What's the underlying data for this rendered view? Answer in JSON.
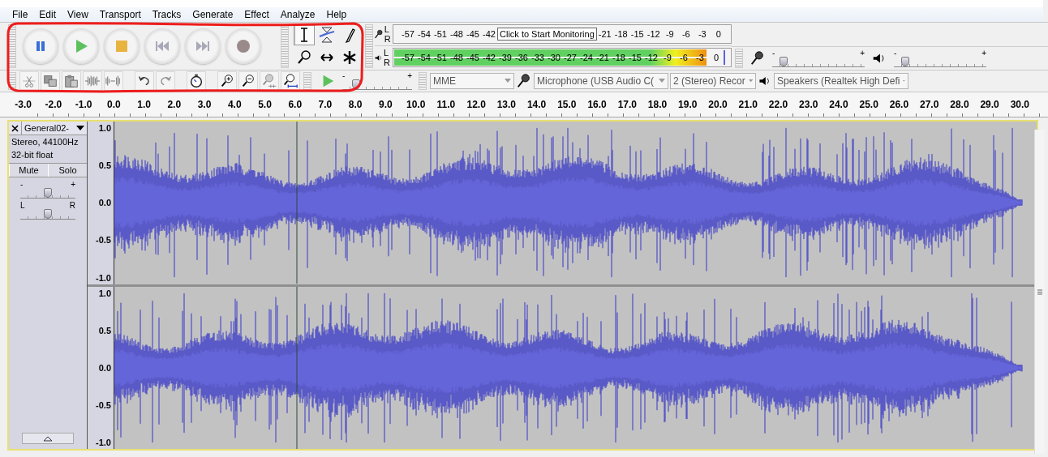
{
  "menu": [
    "File",
    "Edit",
    "View",
    "Transport",
    "Tracks",
    "Generate",
    "Effect",
    "Analyze",
    "Help"
  ],
  "transport": [
    {
      "kind": "pause"
    },
    {
      "kind": "play"
    },
    {
      "kind": "stop"
    },
    {
      "kind": "skip_start"
    },
    {
      "kind": "skip_end"
    },
    {
      "kind": "record"
    }
  ],
  "tools": [
    {
      "kind": "select",
      "selected": true
    },
    {
      "kind": "envelope",
      "selected": false
    },
    {
      "kind": "draw",
      "selected": false
    },
    {
      "kind": "zoom",
      "selected": false
    },
    {
      "kind": "timeshift",
      "selected": false
    },
    {
      "kind": "multi",
      "selected": false
    }
  ],
  "record_meter": {
    "channels": [
      "L",
      "R"
    ],
    "left_labels": [
      "-57",
      "-54",
      "-51",
      "-48",
      "-45",
      "-42"
    ],
    "tooltip": "Click to Start Monitoring",
    "right_labels": [
      "-21",
      "-18",
      "-15",
      "-12",
      "-9",
      "-6",
      "-3",
      "0"
    ]
  },
  "play_meter": {
    "channels": [
      {
        "label": "L",
        "level": 0.93
      },
      {
        "label": "R",
        "level": 0.93
      }
    ],
    "labels": [
      "-57",
      "-54",
      "-51",
      "-48",
      "-45",
      "-42",
      "-39",
      "-36",
      "-33",
      "-30",
      "-27",
      "-24",
      "-21",
      "-18",
      "-15",
      "-12",
      "-9",
      "-6",
      "-3",
      "0"
    ]
  },
  "mixer": [
    {
      "kind": "input",
      "level": 0.12,
      "min_label": "-",
      "max_label": "+"
    },
    {
      "kind": "output",
      "level": 0.12,
      "min_label": "-",
      "max_label": "+"
    }
  ],
  "edit_tools": [
    {
      "kind": "cut"
    },
    {
      "kind": "copy"
    },
    {
      "kind": "paste"
    },
    {
      "kind": "trim"
    },
    {
      "kind": "silence"
    },
    {
      "kind": "undo"
    },
    {
      "kind": "redo"
    },
    {
      "kind": "sync"
    },
    {
      "kind": "zoom_in"
    },
    {
      "kind": "zoom_out"
    },
    {
      "kind": "fit_selection"
    },
    {
      "kind": "fit_project"
    }
  ],
  "play_at_speed": {
    "level": 0.2,
    "min_label": "-",
    "max_label": "+"
  },
  "devices": [
    {
      "kind": "host",
      "value": "MME"
    },
    {
      "kind": "input",
      "value": "Microphone (USB Audio C("
    },
    {
      "kind": "channels",
      "value": "2 (Stereo) Recor"
    },
    {
      "kind": "output",
      "value": "Speakers (Realtek High Defi"
    }
  ],
  "ruler": [
    "-3.0",
    "-2.0",
    "-1.0",
    "0.0",
    "1.0",
    "2.0",
    "3.0",
    "4.0",
    "5.0",
    "6.0",
    "7.0",
    "8.0",
    "9.0",
    "10.0",
    "11.0",
    "12.0",
    "13.0",
    "14.0",
    "15.0",
    "16.0",
    "17.0",
    "18.0",
    "19.0",
    "20.0",
    "21.0",
    "22.0",
    "23.0",
    "24.0",
    "25.0",
    "26.0",
    "27.0",
    "28.0",
    "29.0",
    "30.0"
  ],
  "track": {
    "name": "General02-",
    "info": [
      "Stereo, 44100Hz",
      "32-bit float"
    ],
    "buttons": [
      {
        "label": "Mute",
        "selected": false
      },
      {
        "label": "Solo",
        "selected": false
      }
    ],
    "gain": {
      "level": 0.5,
      "min_label": "-",
      "max_label": "+"
    },
    "pan": {
      "level": 0.5,
      "min_label": "L",
      "max_label": "R"
    },
    "channels": [
      {
        "scale": [
          "1.0",
          "0.5",
          "0.0",
          "-0.5",
          "-1.0"
        ]
      },
      {
        "scale": [
          "1.0",
          "0.5",
          "0.0",
          "-0.5",
          "-1.0"
        ]
      }
    ]
  }
}
